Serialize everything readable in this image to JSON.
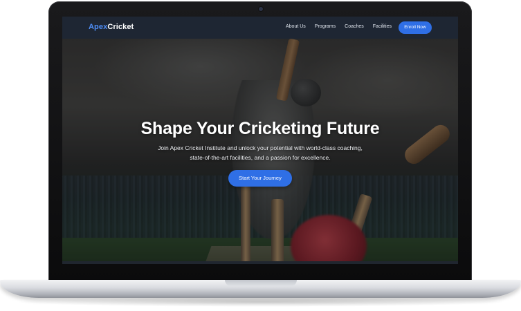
{
  "site": {
    "logo_part1": "Apex",
    "logo_part2": "Cricket",
    "brand_color": "#4f8ef7"
  },
  "nav": {
    "links": [
      "About Us",
      "Programs",
      "Coaches",
      "Facilities"
    ],
    "cta": "Enroll Now",
    "cta_color": "#2f6fe6"
  },
  "hero": {
    "title": "Shape Your Cricketing Future",
    "subtitle_line1": "Join Apex Cricket Institute and unlock your potential with world-class coaching,",
    "subtitle_line2": "state-of-the-art facilities, and a passion for excellence.",
    "cta": "Start Your Journey"
  }
}
